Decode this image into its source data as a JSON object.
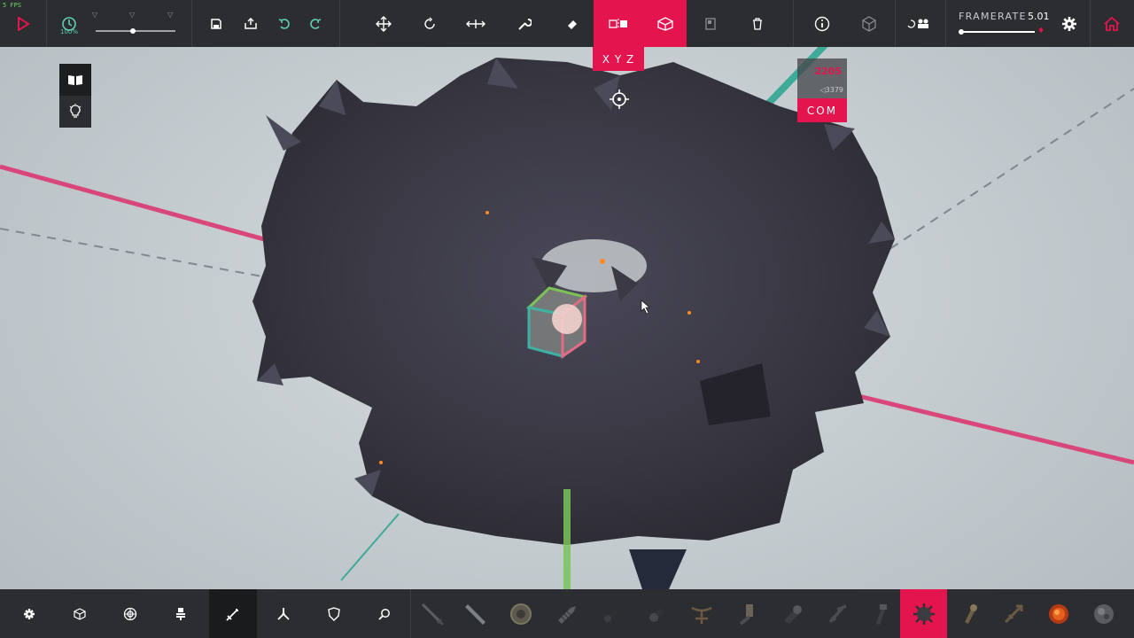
{
  "app": {
    "fps": "5 FPS",
    "timescale": "100%"
  },
  "topbar": {
    "framerate_label": "FRAMERATE",
    "framerate_value": "5.01",
    "icons": [
      "play-icon",
      "clock-icon",
      "undo-icon",
      "redo-icon",
      "translate-icon",
      "rotate-icon",
      "scale-icon",
      "wrench-icon",
      "eraser-icon",
      "mirror-icon",
      "box-icon",
      "copy-icon",
      "trash-icon",
      "info-icon",
      "cube-icon",
      "camera-icon",
      "gear-icon",
      "home-icon"
    ]
  },
  "pivot": {
    "axes": "X Y Z"
  },
  "stats": {
    "value_red": "2205",
    "value_small": "◁3379",
    "com_label": "COM"
  },
  "left_panel": {
    "items": [
      "book-icon",
      "bulb-icon"
    ]
  },
  "bottom_bar": {
    "categories": [
      "basic",
      "blocks",
      "locomotion",
      "mechanical",
      "weaponry",
      "flight",
      "armour",
      "utility"
    ],
    "selected_category": "weaponry",
    "selected_block_index": 11,
    "blocks": [
      "sword",
      "blade",
      "circular-saw",
      "drill",
      "cannon",
      "shrapnel-cannon",
      "crossbow",
      "flamethrower",
      "vacuum",
      "spike-ball",
      "bomb",
      "grabber",
      "harpoon",
      "spear",
      "flaming-ball",
      "fireball"
    ]
  },
  "colors": {
    "accent": "#e4144e",
    "toolbar": "#2b2d30"
  }
}
